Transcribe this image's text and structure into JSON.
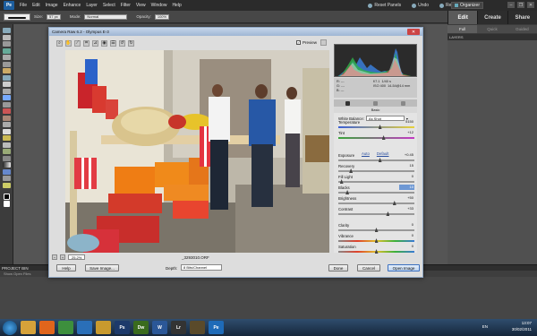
{
  "menubar": {
    "items": [
      "File",
      "Edit",
      "Image",
      "Enhance",
      "Layer",
      "Select",
      "Filter",
      "View",
      "Window",
      "Help"
    ],
    "reset_panels": "Reset Panels",
    "undo": "Undo",
    "redo": "Redo",
    "organizer": "Organizer"
  },
  "options": {
    "size_label": "Size:",
    "size_value": "57 px",
    "mode_label": "Mode:",
    "mode_value": "Normal",
    "opacity_label": "Opacity:",
    "opacity_value": "100%"
  },
  "right_panel": {
    "tabs": [
      "Edit",
      "Create",
      "Share"
    ],
    "active_tab": "Edit",
    "sub_tabs": [
      "Full",
      "Quick",
      "Guided"
    ],
    "active_sub": "Full",
    "layers_header": "LAYERS"
  },
  "project_bin": {
    "header": "PROJECT BIN",
    "sub": "Show Open Files"
  },
  "dialog": {
    "title": "Camera Raw 6.2 - Olympus E-3",
    "preview_label": "Preview",
    "zoom": "25.2%",
    "filename": "_3293010.ORF",
    "rgb": {
      "r": "R:  ---",
      "g": "G:  ---",
      "b": "B:  ---",
      "aperture": "f/7.1",
      "shutter": "1/40 s",
      "iso": "ISO 400",
      "lens": "14-54@14 mm"
    },
    "panel_title": "Basic",
    "white_balance_label": "White Balance:",
    "white_balance_value": "As Shot",
    "auto": "Auto",
    "default": "Default",
    "sliders": [
      {
        "label": "Temperature",
        "value": "5150",
        "pos": 0.55,
        "highlight": false
      },
      {
        "label": "Tint",
        "value": "+12",
        "pos": 0.6,
        "highlight": false
      },
      {
        "label": "Exposure",
        "value": "+0.45",
        "pos": 0.55,
        "highlight": false
      },
      {
        "label": "Recovery",
        "value": "15",
        "pos": 0.15,
        "highlight": false
      },
      {
        "label": "Fill Light",
        "value": "0",
        "pos": 0.02,
        "highlight": false
      },
      {
        "label": "Blacks",
        "value": "10",
        "pos": 0.1,
        "highlight": true
      },
      {
        "label": "Brightness",
        "value": "+50",
        "pos": 0.75,
        "highlight": false
      },
      {
        "label": "Contrast",
        "value": "+33",
        "pos": 0.66,
        "highlight": false
      },
      {
        "label": "Clarity",
        "value": "0",
        "pos": 0.5,
        "highlight": false
      },
      {
        "label": "Vibrance",
        "value": "0",
        "pos": 0.5,
        "highlight": false
      },
      {
        "label": "Saturation",
        "value": "0",
        "pos": 0.5,
        "highlight": false
      }
    ],
    "buttons": {
      "help": "Help",
      "save_image": "Save Image...",
      "depth_label": "Depth:",
      "depth_value": "8 Bits/Channel",
      "done": "Done",
      "cancel": "Cancel",
      "open_image": "Open Image"
    }
  },
  "taskbar": {
    "lang": "EN",
    "time": "13:07",
    "date": "30/02/2011"
  }
}
